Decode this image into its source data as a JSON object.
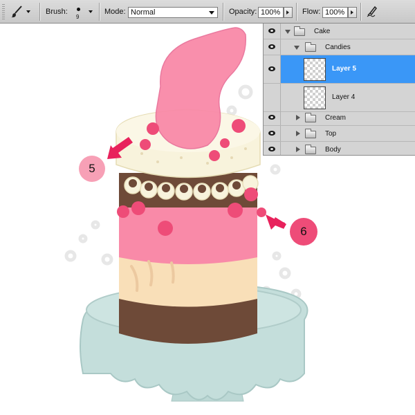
{
  "toolbar": {
    "brush_label": "Brush:",
    "brush_size": "9",
    "mode_label": "Mode:",
    "mode_value": "Normal",
    "opacity_label": "Opacity:",
    "opacity_value": "100%",
    "flow_label": "Flow:",
    "flow_value": "100%"
  },
  "layers": [
    {
      "name": "Cake",
      "kind": "group",
      "expanded": true,
      "visible": true
    },
    {
      "name": "Candies",
      "kind": "group",
      "expanded": true,
      "visible": true
    },
    {
      "name": "Layer 5",
      "kind": "layer",
      "selected": true,
      "visible": true
    },
    {
      "name": "Layer 4",
      "kind": "layer",
      "selected": false,
      "visible": false
    },
    {
      "name": "Cream",
      "kind": "group",
      "expanded": false,
      "visible": true
    },
    {
      "name": "Top",
      "kind": "group",
      "expanded": false,
      "visible": true
    },
    {
      "name": "Body",
      "kind": "group",
      "expanded": false,
      "visible": true
    }
  ],
  "callouts": [
    {
      "label": "5",
      "color": "#f7a0b6"
    },
    {
      "label": "6",
      "color": "#ee4c78"
    }
  ],
  "colors": {
    "selection": "#3a97f7",
    "arrow": "#e8225c",
    "chocolate": "#6e4a38",
    "pink": "#f98aa8",
    "cream": "#f8f3dc",
    "peach": "#f9dfb8",
    "stand": "#c4dedb"
  }
}
